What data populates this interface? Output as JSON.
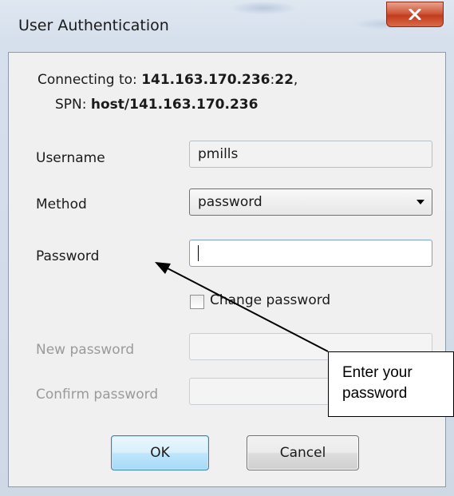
{
  "window": {
    "title": "User Authentication",
    "close_glyph": "close-icon"
  },
  "connection": {
    "prefix": "Connecting to: ",
    "host": "141.163.170.236",
    "sep": ":",
    "port": "22",
    "suffix": ",",
    "spn_label": "SPN: ",
    "spn_value": "host/141.163.170.236"
  },
  "form": {
    "username_label": "Username",
    "username_value": "pmills",
    "method_label": "Method",
    "method_value": "password",
    "password_label": "Password",
    "password_value": "",
    "change_password_label": "Change password",
    "change_password_checked": false,
    "new_password_label": "New password",
    "confirm_password_label": "Confirm password"
  },
  "buttons": {
    "ok": "OK",
    "cancel": "Cancel"
  },
  "annotation": {
    "line1": "Enter your",
    "line2": "password"
  }
}
